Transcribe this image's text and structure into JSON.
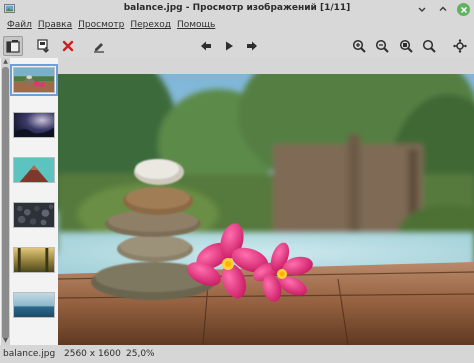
{
  "window": {
    "title": "balance.jpg - Просмотр изображений [1/11]",
    "icon": "image-viewer-icon",
    "controls": [
      "minimize-icon",
      "maximize-icon",
      "close-icon"
    ]
  },
  "menu": {
    "file": "Файл",
    "edit": "Правка",
    "view": "Просмотр",
    "go": "Переход",
    "help": "Помощь"
  },
  "toolbar": {
    "icons": [
      "sidebar-toggle-icon",
      "save-icon",
      "delete-icon",
      "edit-icon",
      "previous-icon",
      "play-icon",
      "next-icon",
      "zoom-in-icon",
      "zoom-out-icon",
      "zoom-fit-icon",
      "zoom-original-icon",
      "fullscreen-icon"
    ],
    "sidebar_toggle_pressed": true
  },
  "thumbnails": [
    {
      "name": "balance",
      "selected": true
    },
    {
      "name": "night-sky",
      "selected": false
    },
    {
      "name": "mountain-teal",
      "selected": false
    },
    {
      "name": "pebbles",
      "selected": false
    },
    {
      "name": "forest-path",
      "selected": false
    },
    {
      "name": "sea-horizon",
      "selected": false
    }
  ],
  "status": {
    "filename": "balance.jpg",
    "dimensions": "2560 x 1600",
    "zoom": "25,0%"
  },
  "colors": {
    "chrome": "#d8d8d8",
    "accent": "#6f9fd8",
    "close_button": "#5fb35f",
    "delete_icon": "#cc1f1f"
  }
}
